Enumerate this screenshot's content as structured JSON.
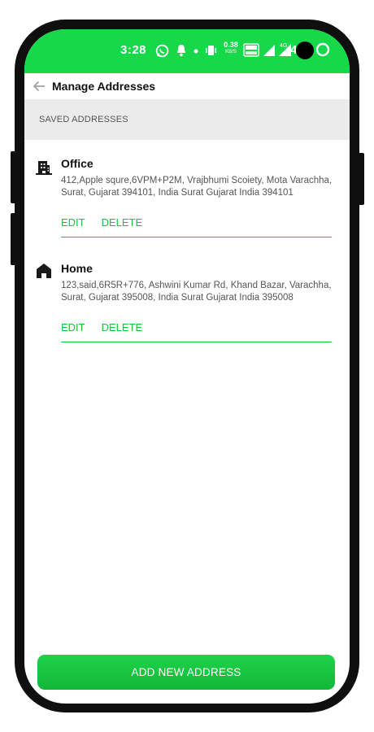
{
  "status_bar": {
    "time": "3:28",
    "net_speed_value": "0.38",
    "net_speed_unit": "KB/S",
    "battery": "4",
    "icons": [
      "whatsapp-icon",
      "notification-bell-icon",
      "dot-icon",
      "vibrate-icon",
      "net-speed-icon",
      "volte-icon",
      "signal-icon",
      "signal-4g-icon",
      "battery-icon"
    ]
  },
  "appbar": {
    "title": "Manage Addresses"
  },
  "section": {
    "label": "SAVED ADDRESSES"
  },
  "addresses": [
    {
      "type_icon": "office-building-icon",
      "name": "Office",
      "text": "412,Apple squre,6VPM+P2M, Vrajbhumi Scoiety, Mota Varachha, Surat, Gujarat 394101, India Surat Gujarat India 394101",
      "edit_label": "EDIT",
      "delete_label": "DELETE"
    },
    {
      "type_icon": "home-icon",
      "name": "Home",
      "text": "123,said,6R5R+776, Ashwini Kumar Rd, Khand Bazar, Varachha, Surat, Gujarat 395008, India Surat Gujarat India 395008",
      "edit_label": "EDIT",
      "delete_label": "DELETE"
    }
  ],
  "add_button": {
    "label": "ADD NEW ADDRESS"
  },
  "colors": {
    "accent": "#16d94a",
    "link": "#16c43e",
    "header_bg": "#ebebeb",
    "frame": "#0f0f0f"
  }
}
